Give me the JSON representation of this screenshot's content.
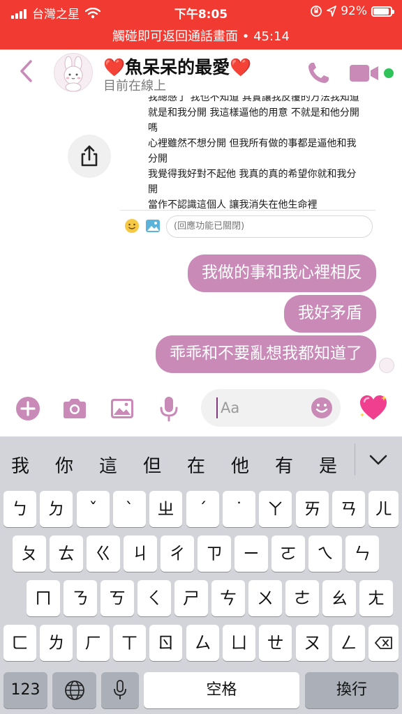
{
  "status_bar": {
    "carrier": "台灣之星",
    "time": "下午8:05",
    "battery_pct": "92%",
    "battery_level": 0.92
  },
  "call_banner": "觸碰即可返回通話畫面 • 45:14",
  "chat": {
    "name": "魚呆呆的最愛",
    "status": "目前在線上",
    "accent_color": "#c98ab8",
    "online_color": "#30c35a"
  },
  "quoted_message": {
    "lines": [
      "我總感了 我也不知道 其實讓我反覆的方法我知道",
      "就是和我分開 我這樣逼他的用意 不就是和他分開",
      "嗎",
      "心裡雖然不想分開 但我所有做的事都是逼他和我",
      "分開",
      "我覺得我好對不起他 我真的真的希望你就和我分",
      "開",
      "當作不認識這個人 讓我消失在他生命裡"
    ],
    "reply_placeholder": "(回應功能已關閉)"
  },
  "messages": [
    {
      "text": "我做的事和我心裡相反"
    },
    {
      "text": "我好矛盾"
    },
    {
      "text": "乖乖和不要亂想我都知道了"
    }
  ],
  "composer": {
    "placeholder": "Aa"
  },
  "keyboard": {
    "suggestions": [
      "我",
      "你",
      "這",
      "但",
      "在",
      "他",
      "有",
      "是"
    ],
    "row1": [
      "ㄅ",
      "ㄉ",
      "ˇ",
      "ˋ",
      "ㄓ",
      "ˊ",
      "˙",
      "ㄚ",
      "ㄞ",
      "ㄢ",
      "ㄦ"
    ],
    "row2": [
      "ㄆ",
      "ㄊ",
      "ㄍ",
      "ㄐ",
      "ㄔ",
      "ㄗ",
      "ㄧ",
      "ㄛ",
      "ㄟ",
      "ㄣ"
    ],
    "row3": [
      "ㄇ",
      "ㄋ",
      "ㄎ",
      "ㄑ",
      "ㄕ",
      "ㄘ",
      "ㄨ",
      "ㄜ",
      "ㄠ",
      "ㄤ"
    ],
    "row4": [
      "ㄈ",
      "ㄌ",
      "ㄏ",
      "ㄒ",
      "ㄖ",
      "ㄙ",
      "ㄩ",
      "ㄝ",
      "ㄡ",
      "ㄥ"
    ],
    "numbers_label": "123",
    "space_label": "空格",
    "return_label": "換行"
  }
}
